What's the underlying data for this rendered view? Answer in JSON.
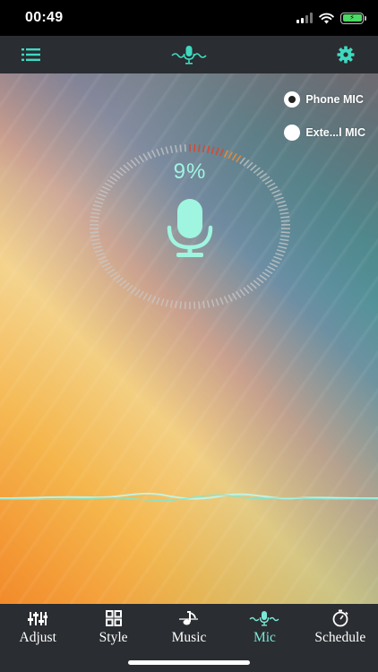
{
  "status_bar": {
    "time": "00:49",
    "icons": [
      "signal-icon",
      "wifi-icon",
      "battery-charging-icon"
    ]
  },
  "header": {
    "menu_icon": "list-menu-icon",
    "mic_wave_icon": "mic-wave-icon",
    "settings_icon": "gear-icon",
    "accent": "#3fd9c0"
  },
  "mic_sources": {
    "options": [
      {
        "label": "Phone MIC",
        "selected": true
      },
      {
        "label": "Exte...l MIC",
        "selected": false
      }
    ]
  },
  "level_meter": {
    "percent_text": "9%",
    "level": 0.09,
    "icon": "microphone-icon",
    "colors": {
      "text": "#9ff5df",
      "ticks": "#c8c8c8",
      "active": "#d44a32",
      "active_end": "#e38a3c"
    }
  },
  "tabs": [
    {
      "label": "Adjust",
      "icon": "sliders-icon",
      "active": false
    },
    {
      "label": "Style",
      "icon": "grid-icon",
      "active": false
    },
    {
      "label": "Music",
      "icon": "music-note-icon",
      "active": false
    },
    {
      "label": "Mic",
      "icon": "mic-wave-icon",
      "active": true
    },
    {
      "label": "Schedule",
      "icon": "timer-icon",
      "active": false
    }
  ],
  "colors": {
    "active_tab": "#7be8d6",
    "bar_bg": "#2a2d31"
  }
}
